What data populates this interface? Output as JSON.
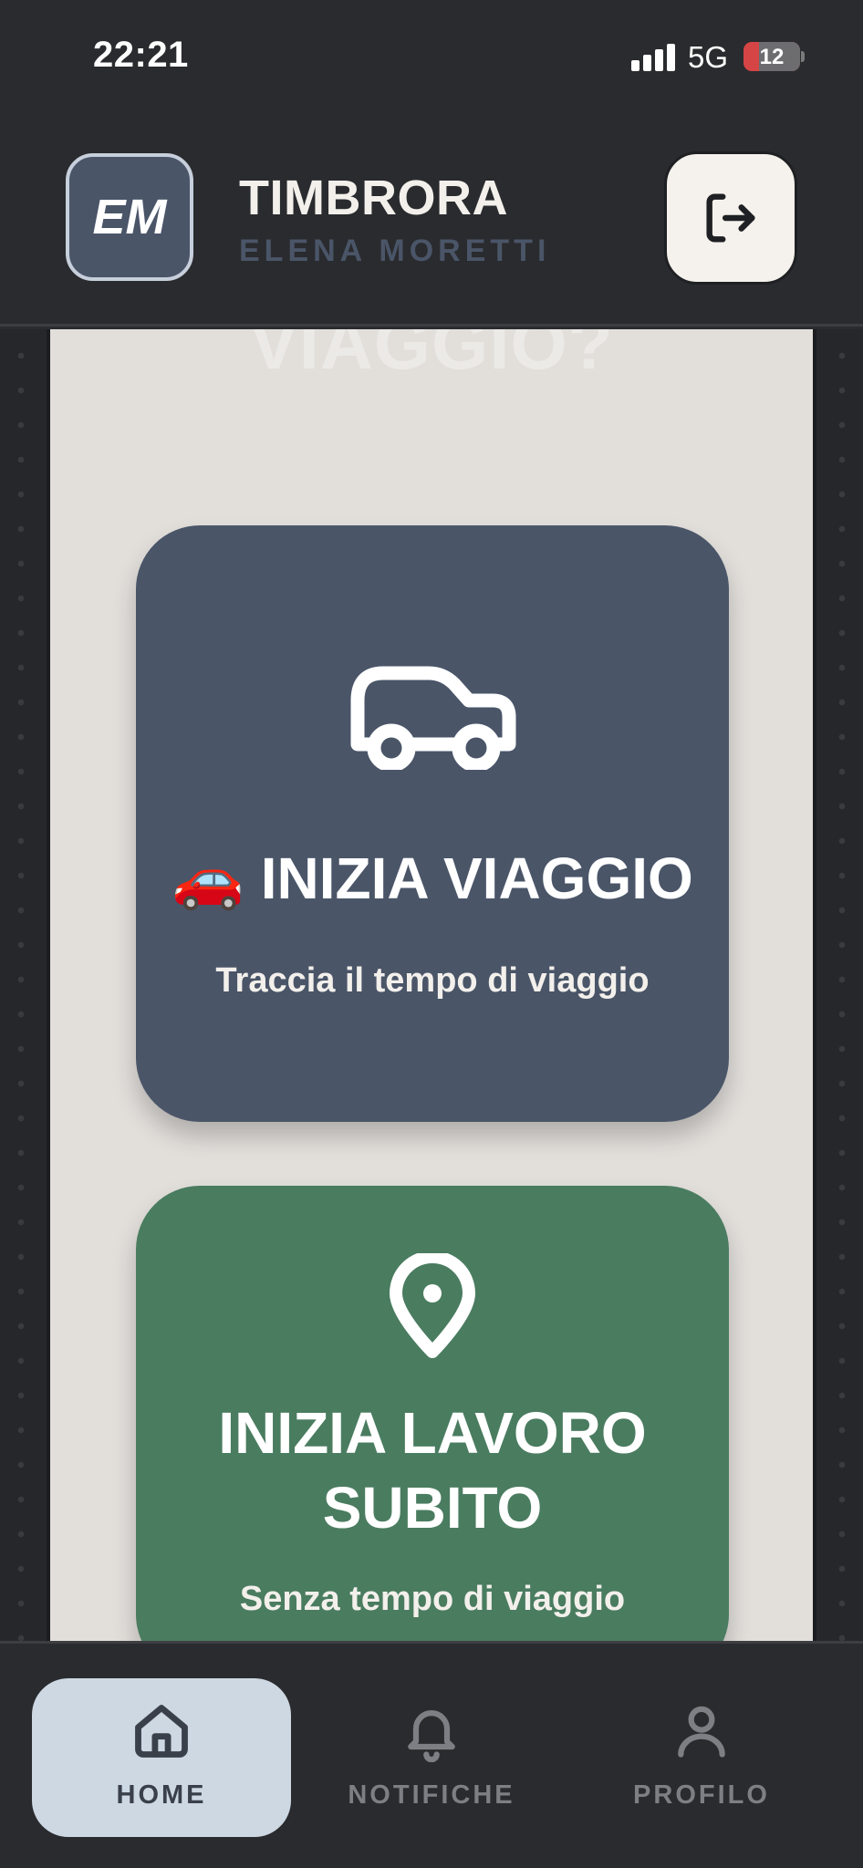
{
  "status_bar": {
    "time": "22:21",
    "network": "5G",
    "battery": "12"
  },
  "header": {
    "avatar_initials": "EM",
    "app_name": "TIMBRORA",
    "user_name": "ELENA MORETTI",
    "logout_icon": "logout-icon"
  },
  "main": {
    "heading_partial": "VIAGGIO?",
    "cards": [
      {
        "icon": "car-icon",
        "title": "🚗 INIZIA VIAGGIO",
        "subtitle": "Traccia il tempo di viaggio",
        "color": "#4a5568"
      },
      {
        "icon": "map-pin-icon",
        "title_line1": "INIZIA LAVORO",
        "title_line2": "SUBITO",
        "subtitle": "Senza tempo di viaggio",
        "color": "#4a7c60"
      }
    ]
  },
  "nav": {
    "items": [
      {
        "label": "HOME",
        "icon": "home-icon",
        "active": true
      },
      {
        "label": "NOTIFICHE",
        "icon": "bell-icon",
        "active": false
      },
      {
        "label": "PROFILO",
        "icon": "user-icon",
        "active": false
      }
    ]
  },
  "colors": {
    "background": "#2a2b2e",
    "panel": "#e2dfdb",
    "accent_slate": "#4a5568",
    "accent_green": "#4a7c60",
    "nav_active": "#cdd8e3"
  }
}
